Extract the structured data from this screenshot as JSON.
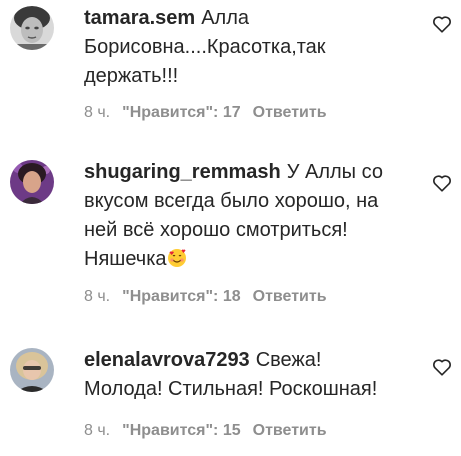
{
  "comments": [
    {
      "username": "tamara.sem",
      "text": "Алла Борисовна....Красотка,так держать!!!",
      "time": "8 ч.",
      "likes": "\"Нравится\": 17",
      "reply": "Ответить",
      "avatar_icon": "avatar-woman-bw"
    },
    {
      "username": "shugaring_remmash",
      "text": "У Аллы со вкусом всегда было хорошо, на ней всё хорошо смотриться! Няшечка",
      "emoji": "smiling-face-with-hearts",
      "time": "8 ч.",
      "likes": "\"Нравится\": 18",
      "reply": "Ответить",
      "avatar_icon": "avatar-woman-purple"
    },
    {
      "username": "elenalavrova7293",
      "text": "Свежа! Молода! Стильная! Роскошная!",
      "time": "8 ч.",
      "likes": "\"Нравится\": 15",
      "reply": "Ответить",
      "avatar_icon": "avatar-woman-blonde"
    }
  ],
  "icons": {
    "like": "heart-outline-icon"
  },
  "colors": {
    "text": "#262626",
    "meta": "#8e8e8e"
  }
}
